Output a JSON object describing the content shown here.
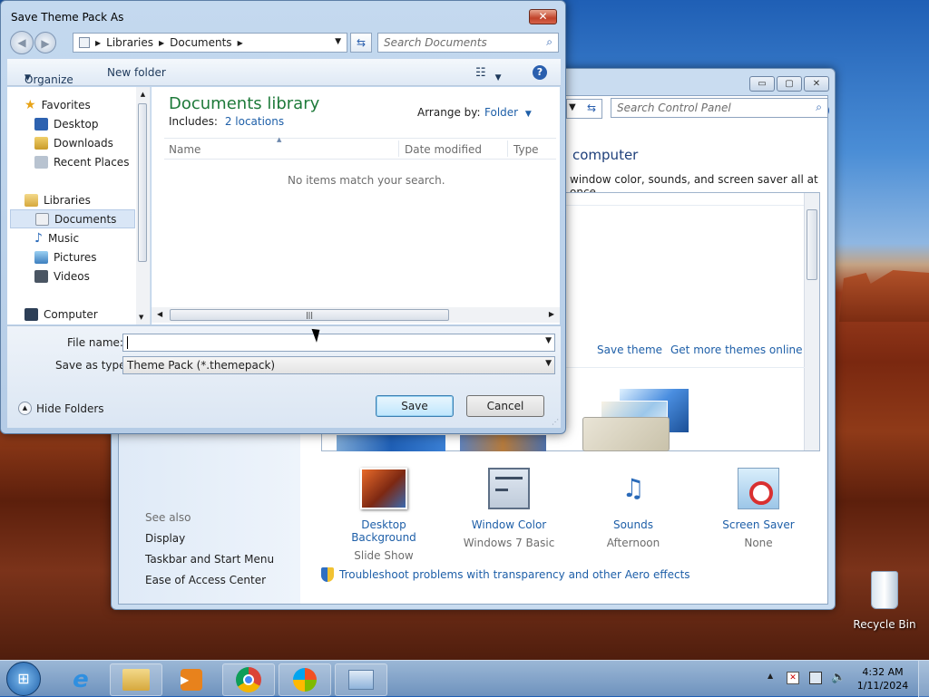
{
  "dialog": {
    "title": "Save Theme Pack As",
    "close_glyph": "✕",
    "address": {
      "segments": [
        "Libraries",
        "Documents"
      ]
    },
    "search_placeholder": "Search Documents",
    "toolbar": {
      "organize": "Organize",
      "new_folder": "New folder"
    },
    "nav": {
      "favorites": "Favorites",
      "favorites_items": [
        "Desktop",
        "Downloads",
        "Recent Places"
      ],
      "libraries": "Libraries",
      "libraries_items": [
        "Documents",
        "Music",
        "Pictures",
        "Videos"
      ],
      "computer": "Computer"
    },
    "content": {
      "library_title": "Documents library",
      "includes_label": "Includes:",
      "includes_link": "2 locations",
      "arrange_by_label": "Arrange by:",
      "arrange_by_value": "Folder",
      "columns": [
        "Name",
        "Date modified",
        "Type"
      ],
      "empty_message": "No items match your search."
    },
    "file_name_label": "File name:",
    "file_name_value": "",
    "save_as_type_label": "Save as type:",
    "save_as_type_value": "Theme Pack (*.themepack)",
    "hide_folders": "Hide Folders",
    "save_button": "Save",
    "cancel_button": "Cancel"
  },
  "control_panel": {
    "search_placeholder": "Search Control Panel",
    "heading_partial": "computer",
    "subheading_partial": "window color, sounds, and screen saver all at once.",
    "save_theme": "Save theme",
    "get_more_themes": "Get more themes online",
    "see_also": "See also",
    "see_also_links": [
      "Display",
      "Taskbar and Start Menu",
      "Ease of Access Center"
    ],
    "settings": [
      {
        "title": "Desktop Background",
        "value": "Slide Show"
      },
      {
        "title": "Window Color",
        "value": "Windows 7 Basic"
      },
      {
        "title": "Sounds",
        "value": "Afternoon"
      },
      {
        "title": "Screen Saver",
        "value": "None"
      }
    ],
    "troubleshoot": "Troubleshoot problems with transparency and other Aero effects",
    "window_buttons": [
      "▭",
      "▢",
      "✕"
    ]
  },
  "desktop": {
    "recycle_bin": "Recycle Bin"
  },
  "taskbar": {
    "time": "4:32 AM",
    "date": "1/11/2024"
  }
}
